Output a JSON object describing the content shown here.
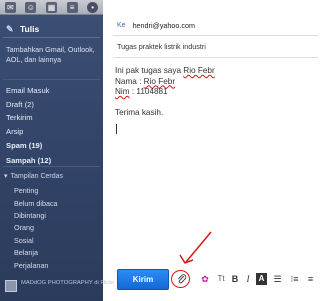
{
  "sidebar": {
    "compose_label": "Tulis",
    "add_accounts": "Tambahkan Gmail, Outlook, AOL, dan lainnya",
    "items": [
      {
        "label": "Email Masuk",
        "bold": false
      },
      {
        "label": "Draft (2)",
        "bold": false
      },
      {
        "label": "Terkirim",
        "bold": false
      },
      {
        "label": "Arsip",
        "bold": false
      },
      {
        "label": "Spam (19)",
        "bold": true
      },
      {
        "label": "Sampah (12)",
        "bold": true
      }
    ],
    "smart_views_label": "Tampilan Cerdas",
    "smart_views": [
      "Penting",
      "Belum dibaca",
      "Dibintangi",
      "Orang",
      "Sosial",
      "Belanja",
      "Perjalanan"
    ],
    "photo_credit": "MADdOG PHOTOGRAPHY di Flickr"
  },
  "compose": {
    "to_label": "Ke",
    "to_value": "hendri@yahoo.com",
    "subject": "Tugas praktek listrik industri",
    "body": {
      "line1_prefix": "Ini pak tugas saya ",
      "line1_name": "Rio Febr",
      "line2_prefix": "Nama : ",
      "line2_name": "Rio Febr",
      "line3_label": "Nim",
      "line3_rest": " : 1104881",
      "line4": "Terima kasih."
    },
    "send_label": "Kirim"
  },
  "toolbar_icons": [
    "attachment-icon",
    "emoji-icon",
    "text-size-icon",
    "bold-icon",
    "italic-icon",
    "text-color-icon",
    "bullet-list-icon",
    "numbered-list-icon",
    "align-icon"
  ],
  "colors": {
    "sidebar_bg": "#314366",
    "send_button": "#1a77e6",
    "annotation": "#d81818",
    "link_label": "#3c6fb4"
  }
}
